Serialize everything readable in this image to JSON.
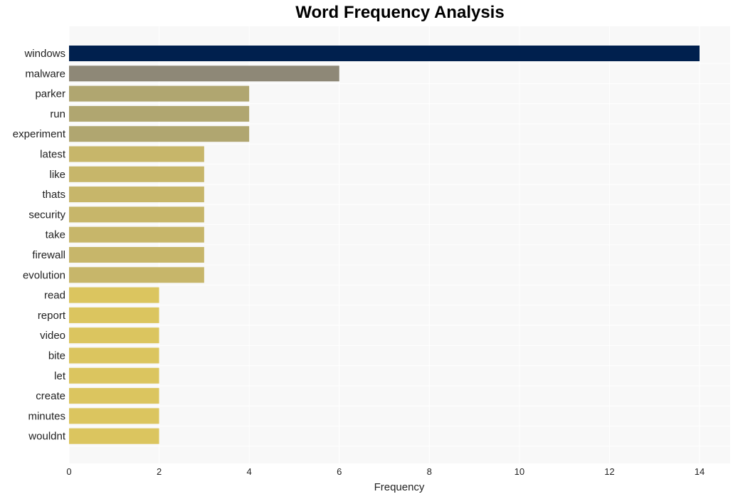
{
  "chart_data": {
    "type": "bar",
    "orientation": "horizontal",
    "title": "Word Frequency Analysis",
    "xlabel": "Frequency",
    "ylabel": "",
    "xlim": [
      0,
      14.7
    ],
    "xticks": [
      0,
      2,
      4,
      6,
      8,
      10,
      12,
      14
    ],
    "grid": true,
    "categories": [
      "windows",
      "malware",
      "parker",
      "run",
      "experiment",
      "latest",
      "like",
      "thats",
      "security",
      "take",
      "firewall",
      "evolution",
      "read",
      "report",
      "video",
      "bite",
      "let",
      "create",
      "minutes",
      "wouldnt"
    ],
    "values": [
      14,
      6,
      4,
      4,
      4,
      3,
      3,
      3,
      3,
      3,
      3,
      3,
      2,
      2,
      2,
      2,
      2,
      2,
      2,
      2
    ],
    "colors": {
      "14": "#00204e",
      "6": "#8e8877",
      "4": "#b0a670",
      "3": "#c7b66a",
      "2": "#dbc55f"
    },
    "background": "#f8f8f8"
  }
}
